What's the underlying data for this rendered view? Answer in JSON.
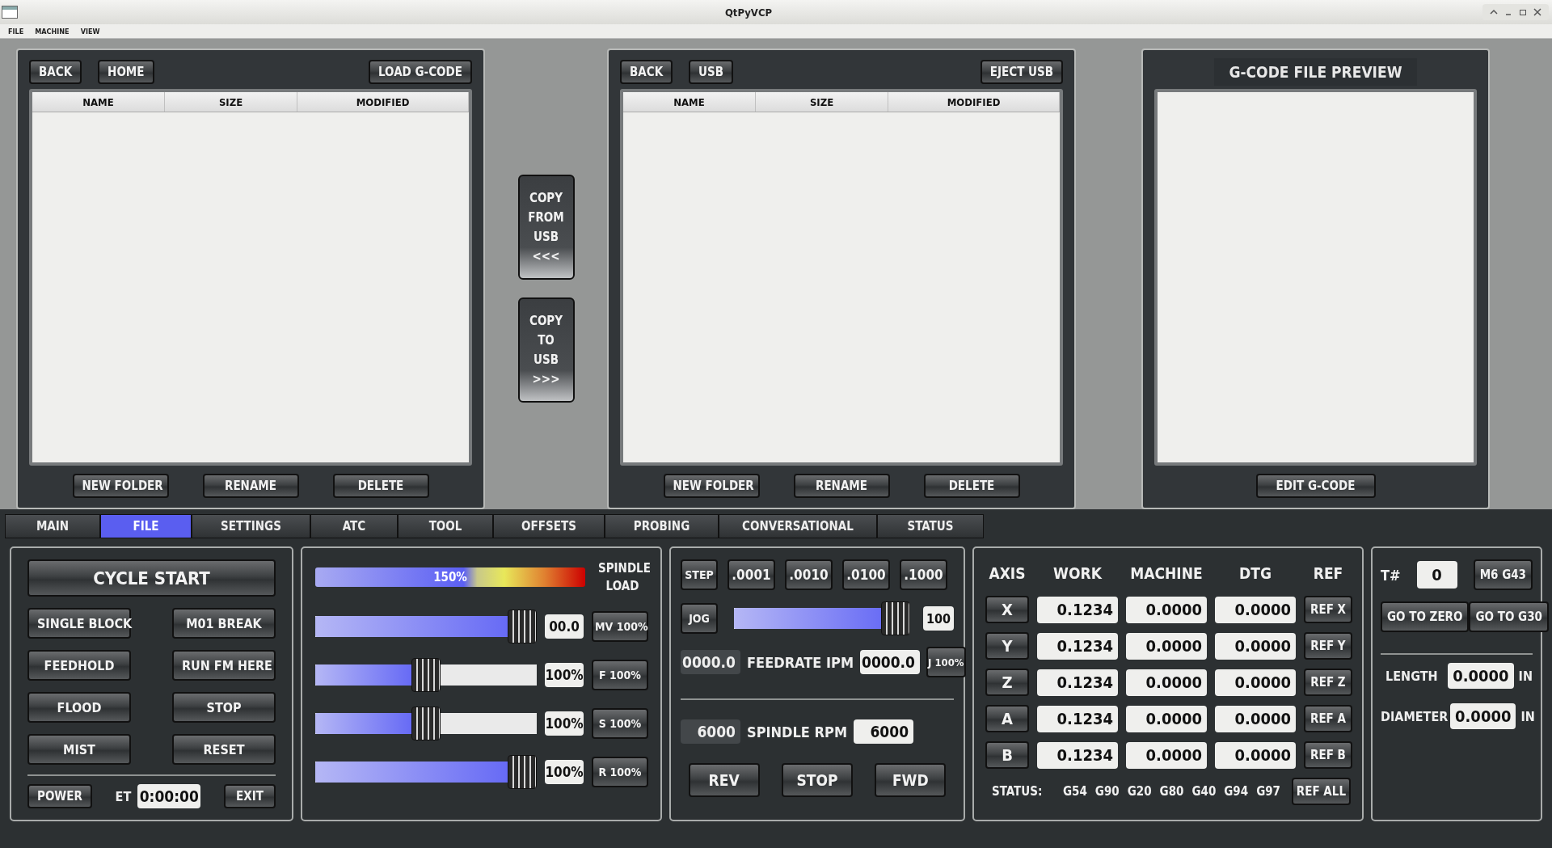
{
  "window": {
    "title": "QtPyVCP"
  },
  "menu": [
    "FILE",
    "MACHINE",
    "VIEW"
  ],
  "local_files": {
    "nav": [
      "BACK",
      "HOME"
    ],
    "load": "LOAD G-CODE",
    "columns": [
      "NAME",
      "SIZE",
      "MODIFIED"
    ],
    "actions": [
      "NEW FOLDER",
      "RENAME",
      "DELETE"
    ]
  },
  "transfer": [
    {
      "lines": [
        "COPY",
        "FROM",
        "USB",
        "<<<"
      ]
    },
    {
      "lines": [
        "COPY",
        "TO",
        "USB",
        ">>>"
      ]
    }
  ],
  "usb_files": {
    "nav": [
      "BACK",
      "USB"
    ],
    "eject": "EJECT USB",
    "columns": [
      "NAME",
      "SIZE",
      "MODIFIED"
    ],
    "actions": [
      "NEW FOLDER",
      "RENAME",
      "DELETE"
    ]
  },
  "preview": {
    "title": "G-CODE FILE PREVIEW",
    "button": "EDIT G-CODE"
  },
  "tabs": [
    {
      "label": "MAIN",
      "selected": false
    },
    {
      "label": "FILE",
      "selected": true
    },
    {
      "label": "SETTINGS",
      "selected": false
    },
    {
      "label": "ATC",
      "selected": false
    },
    {
      "label": "TOOL",
      "selected": false
    },
    {
      "label": "OFFSETS",
      "selected": false
    },
    {
      "label": "PROBING",
      "selected": false
    },
    {
      "label": "CONVERSATIONAL",
      "selected": false
    },
    {
      "label": "STATUS",
      "selected": false
    }
  ],
  "program": {
    "cycle_start": "CYCLE START",
    "buttons": [
      "SINGLE BLOCK",
      "M01 BREAK",
      "FEEDHOLD",
      "RUN FM HERE",
      "FLOOD",
      "STOP",
      "MIST",
      "RESET"
    ],
    "power": "POWER",
    "et_label": "ET",
    "et_value": "0:00:00",
    "exit": "EXIT"
  },
  "overrides": {
    "spindle_load": {
      "reading": "150%",
      "label": "SPINDLE LOAD"
    },
    "sliders": [
      {
        "level": 1,
        "value": "00.0",
        "button": "MV 100%"
      },
      {
        "level": 0.5,
        "value": "100%",
        "button": "F 100%"
      },
      {
        "level": 0.5,
        "value": "100%",
        "button": "S 100%"
      },
      {
        "level": 1,
        "value": "100%",
        "button": "R 100%"
      }
    ]
  },
  "jog": {
    "step_label": "STEP",
    "steps": [
      ".0001",
      ".0010",
      ".0100",
      ".1000"
    ],
    "jog_label": "JOG",
    "jog_slider": {
      "level": 1
    },
    "jog_value": "100",
    "feed_actual": "0000.0",
    "feed_label": "FEEDRATE IPM",
    "feed_value": "0000.0",
    "feed_button": "J 100%",
    "rpm_actual": "6000",
    "rpm_label": "SPINDLE RPM",
    "rpm_value": "6000",
    "spindle_buttons": [
      "REV",
      "STOP",
      "FWD"
    ]
  },
  "dro": {
    "columns": [
      "AXIS",
      "WORK",
      "MACHINE",
      "DTG",
      "REF"
    ],
    "rows": [
      {
        "axis": "X",
        "work": "0.1234",
        "machine": "0.0000",
        "dtg": "0.0000",
        "ref": "REF X"
      },
      {
        "axis": "Y",
        "work": "0.1234",
        "machine": "0.0000",
        "dtg": "0.0000",
        "ref": "REF Y"
      },
      {
        "axis": "Z",
        "work": "0.1234",
        "machine": "0.0000",
        "dtg": "0.0000",
        "ref": "REF Z"
      },
      {
        "axis": "A",
        "work": "0.1234",
        "machine": "0.0000",
        "dtg": "0.0000",
        "ref": "REF A"
      },
      {
        "axis": "B",
        "work": "0.1234",
        "machine": "0.0000",
        "dtg": "0.0000",
        "ref": "REF B"
      }
    ],
    "status_label": "STATUS:",
    "codes": [
      "G54",
      "G90",
      "G20",
      "G80",
      "G40",
      "G94",
      "G97"
    ],
    "ref_all": "REF ALL"
  },
  "tool": {
    "t_label": "T#",
    "t_value": "0",
    "m6": "M6 G43",
    "go_zero": "GO TO ZERO",
    "go_g30": "GO TO G30",
    "length_label": "LENGTH",
    "length_value": "0.0000",
    "length_unit": "IN",
    "diameter_label": "DIAMETER",
    "diameter_value": "0.0000",
    "diameter_unit": "IN"
  }
}
